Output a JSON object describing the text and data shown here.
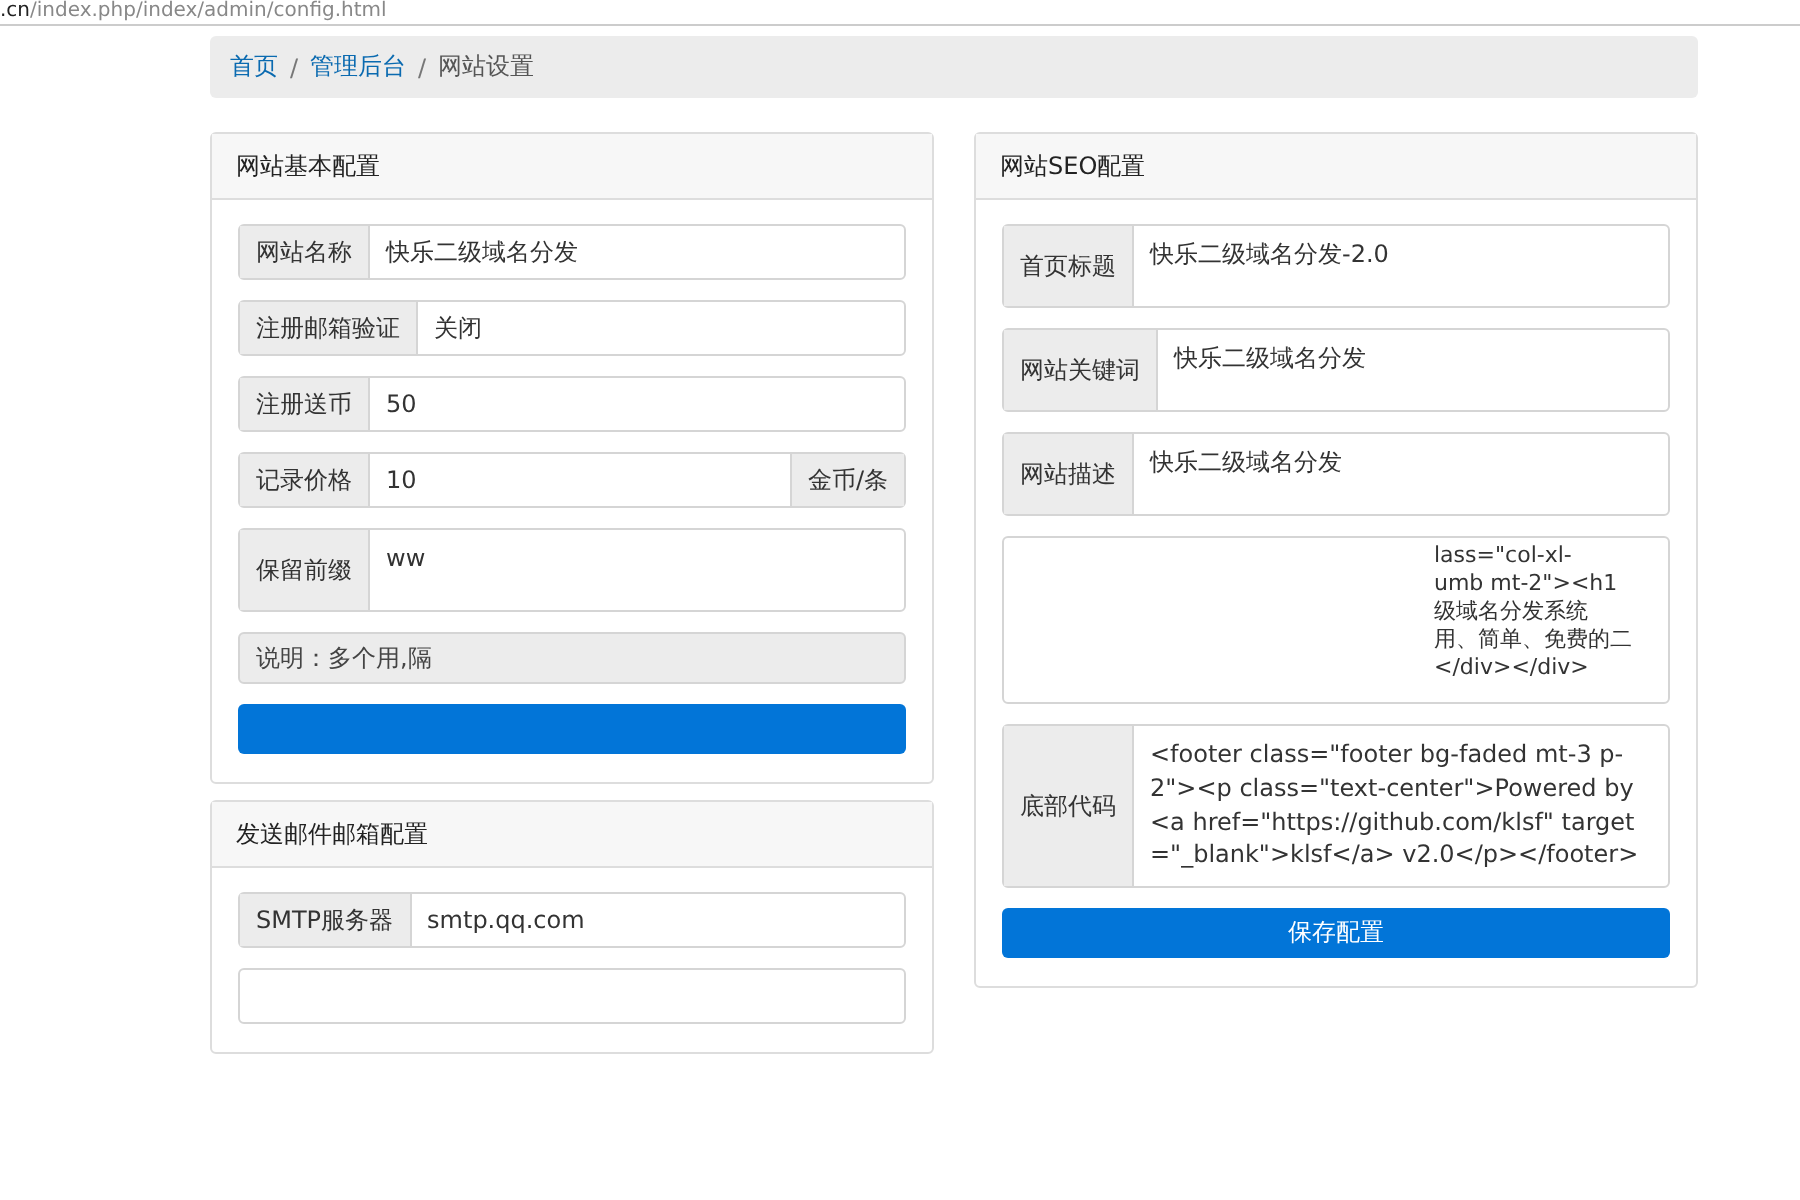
{
  "address_bar": {
    "host": ".cn",
    "path": "/index.php/index/admin/config.html"
  },
  "breadcrumb": {
    "separator": "/",
    "items": [
      {
        "label": "首页",
        "link": true
      },
      {
        "label": "管理后台",
        "link": true
      },
      {
        "label": "网站设置",
        "link": false
      }
    ]
  },
  "basic_panel": {
    "title": "网站基本配置",
    "fields": [
      {
        "kind": "input",
        "label": "网站名称",
        "value": "快乐二级域名分发"
      },
      {
        "kind": "input",
        "label": "注册邮箱验证",
        "value": "关闭"
      },
      {
        "kind": "input",
        "label": "注册送币",
        "value": "50"
      },
      {
        "kind": "input",
        "label": "记录价格",
        "value": "10",
        "suffix": "金币/条"
      },
      {
        "kind": "textarea",
        "label": "保留前缀",
        "value": "ww"
      },
      {
        "kind": "note",
        "value": "说明：多个用,隔"
      }
    ]
  },
  "seo_panel": {
    "title": "网站SEO配置",
    "fields": [
      {
        "kind": "textarea",
        "label": "首页标题",
        "value": "快乐二级域名分发-2.0"
      },
      {
        "kind": "textarea",
        "label": "网站关键词",
        "value": "快乐二级域名分发"
      },
      {
        "kind": "textarea",
        "label": "网站描述",
        "value": "快乐二级域名分发"
      },
      {
        "kind": "partial",
        "lines": [
          "lass=\"col-xl-",
          "umb mt-2\"><h1",
          "级域名分发系统",
          "用、简单、免费的二",
          "</div></div>"
        ]
      },
      {
        "kind": "code",
        "label": "底部代码",
        "value": "<footer class=\"footer bg-faded mt-3 p-2\"><p class=\"text-center\">Powered by <a href=\"https://github.com/klsf\" target=\"_blank\">klsf</a> v2.0</p></footer>"
      }
    ],
    "button": "保存配置"
  },
  "mail_panel": {
    "title": "发送邮件邮箱配置",
    "fields": [
      {
        "kind": "input",
        "label": "SMTP服务器",
        "value": "smtp.qq.com"
      },
      {
        "kind": "input"
      }
    ]
  }
}
